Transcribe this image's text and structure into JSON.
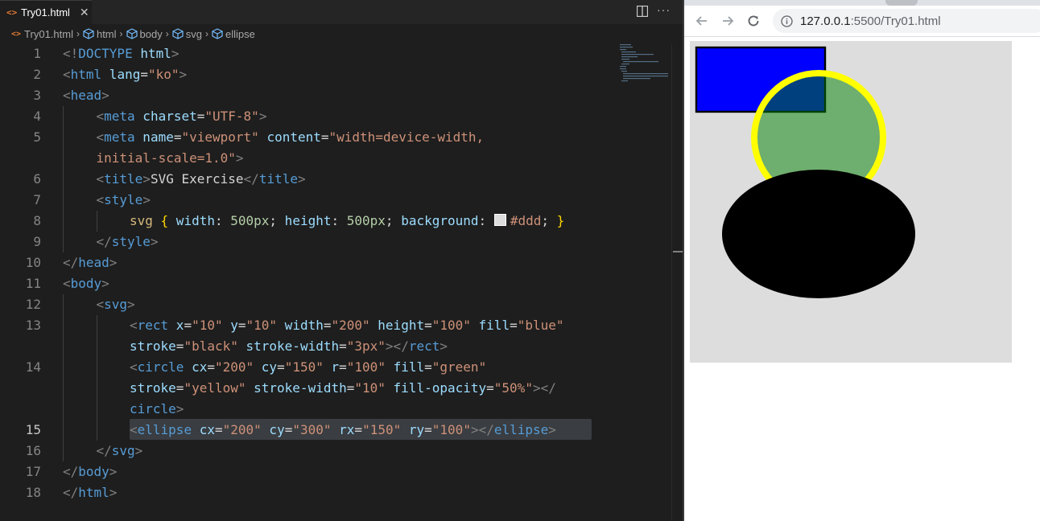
{
  "editor": {
    "tab": {
      "icon": "<>",
      "title": "Try01.html",
      "close": "✕"
    },
    "more": "···",
    "breadcrumb": [
      "Try01.html",
      "html",
      "body",
      "svg",
      "ellipse"
    ],
    "line_numbers": [
      "1",
      "2",
      "3",
      "4",
      "5",
      "",
      "6",
      "7",
      "8",
      "9",
      "10",
      "11",
      "12",
      "13",
      "",
      "14",
      "",
      "",
      "15",
      "16",
      "17",
      "18"
    ],
    "code": {
      "l1": [
        "<!",
        "DOCTYPE",
        " html",
        ">"
      ],
      "l2": [
        "<",
        "html",
        " lang",
        "=",
        "\"ko\"",
        ">"
      ],
      "l3": [
        "<",
        "head",
        ">"
      ],
      "l4": [
        "<",
        "meta",
        " charset",
        "=",
        "\"UTF-8\"",
        ">"
      ],
      "l5a": [
        "<",
        "meta",
        " name",
        "=",
        "\"viewport\"",
        " content",
        "=",
        "\"width=device-width,"
      ],
      "l5b": [
        "initial-scale=1.0\"",
        ">"
      ],
      "l6": [
        "<",
        "title",
        ">",
        "SVG Exercise",
        "</",
        "title",
        ">"
      ],
      "l7": [
        "<",
        "style",
        ">"
      ],
      "l8": [
        "svg",
        " {",
        " width",
        ":",
        " 500px",
        ";",
        " height",
        ":",
        " 500px",
        ";",
        " background",
        ":",
        "#ddd",
        ";",
        " }"
      ],
      "l9": [
        "</",
        "style",
        ">"
      ],
      "l10": [
        "</",
        "head",
        ">"
      ],
      "l11": [
        "<",
        "body",
        ">"
      ],
      "l12": [
        "<",
        "svg",
        ">"
      ],
      "l13a": [
        "<",
        "rect",
        " x",
        "=",
        "\"10\"",
        " y",
        "=",
        "\"10\"",
        " width",
        "=",
        "\"200\"",
        " height",
        "=",
        "\"100\"",
        " fill",
        "=",
        "\"blue\""
      ],
      "l13b": [
        "stroke",
        "=",
        "\"black\"",
        " stroke-width",
        "=",
        "\"3px\"",
        "></",
        "rect",
        ">"
      ],
      "l14a": [
        "<",
        "circle",
        " cx",
        "=",
        "\"200\"",
        " cy",
        "=",
        "\"150\"",
        " r",
        "=",
        "\"100\"",
        " fill",
        "=",
        "\"green\""
      ],
      "l14b": [
        "stroke",
        "=",
        "\"yellow\"",
        " stroke-width",
        "=",
        "\"10\"",
        " fill-opacity",
        "=",
        "\"50%\"",
        "></"
      ],
      "l14c": [
        "circle",
        ">"
      ],
      "l15": [
        "<",
        "ellipse",
        " cx",
        "=",
        "\"200\"",
        " cy",
        "=",
        "\"300\"",
        " rx",
        "=",
        "\"150\"",
        " ry",
        "=",
        "\"100\"",
        "></",
        "ellipse",
        ">"
      ],
      "l16": [
        "</",
        "svg",
        ">"
      ],
      "l17": [
        "</",
        "body",
        ">"
      ],
      "l18": [
        "</",
        "html",
        ">"
      ]
    }
  },
  "browser": {
    "url_host": "127.0.0.1",
    "url_rest": ":5500/Try01.html",
    "svg_background": "#dddddd",
    "shapes": {
      "rect": {
        "fill": "#0000ff",
        "stroke": "#000000"
      },
      "circle": {
        "fill": "#008000",
        "stroke": "#ffff00",
        "fill_opacity": 0.5
      },
      "ellipse": {
        "fill": "#000000"
      }
    }
  }
}
